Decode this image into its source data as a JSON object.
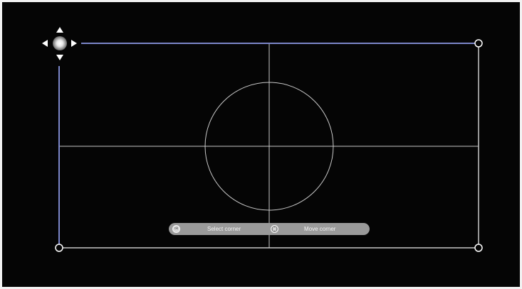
{
  "screen": {
    "background_color": "#050505",
    "grid_line_color": "#c8c8c8",
    "active_edge_color": "#7b86c9",
    "corner_handle_color": "#ffffff"
  },
  "corners": {
    "selected": "top-left",
    "handles": [
      "top-right",
      "bottom-left",
      "bottom-right"
    ]
  },
  "nav_pad": {
    "icons": [
      "arrow-up-icon",
      "arrow-down-icon",
      "arrow-left-icon",
      "arrow-right-icon",
      "nav-center-icon"
    ]
  },
  "hint_bar": {
    "select_label": "Select corner",
    "select_icon": "ok",
    "move_label": "Move corner",
    "move_icon": "dpad"
  }
}
